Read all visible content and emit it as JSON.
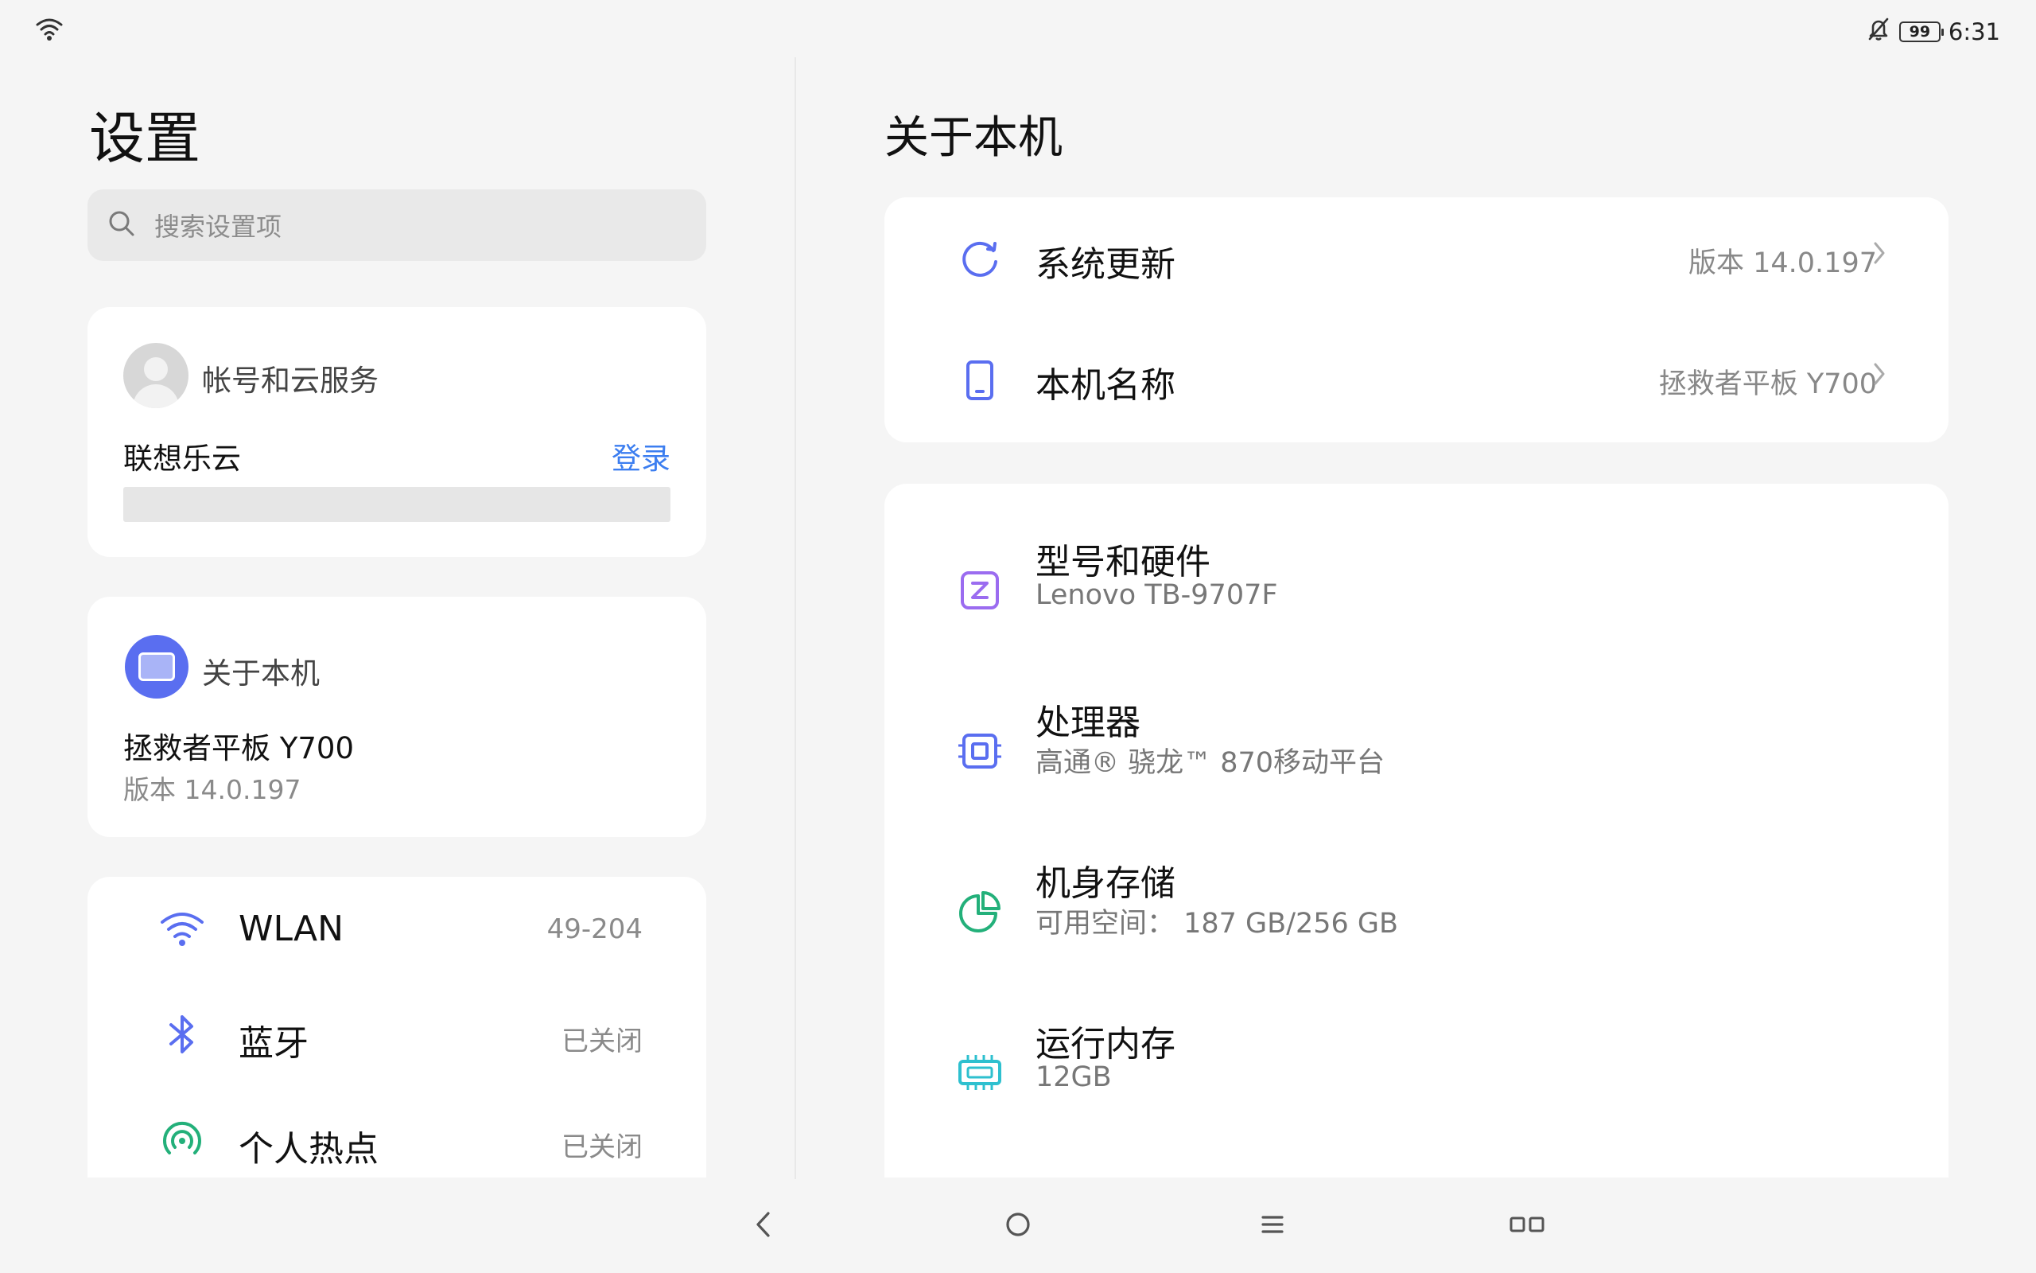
{
  "status_bar": {
    "time": "6:31",
    "battery": "99"
  },
  "left": {
    "title": "设置",
    "search_placeholder": "搜索设置项",
    "account": {
      "title": "帐号和云服务",
      "cloud_name": "联想乐云",
      "login_label": "登录"
    },
    "about": {
      "title": "关于本机",
      "device_name": "拯救者平板 Y700",
      "version": "版本 14.0.197"
    },
    "network": [
      {
        "label": "WLAN",
        "value": "49-204"
      },
      {
        "label": "蓝牙",
        "value": "已关闭"
      },
      {
        "label": "个人热点",
        "value": "已关闭"
      }
    ]
  },
  "right": {
    "title": "关于本机",
    "top_items": [
      {
        "label": "系统更新",
        "value": "版本 14.0.197"
      },
      {
        "label": "本机名称",
        "value": "拯救者平板 Y700"
      }
    ],
    "hardware_items": [
      {
        "label": "型号和硬件",
        "sub": "Lenovo TB-9707F"
      },
      {
        "label": "处理器",
        "sub": "高通® 骁龙™ 870移动平台"
      },
      {
        "label": "机身存储",
        "sub": "可用空间：  187 GB/256 GB"
      },
      {
        "label": "运行内存",
        "sub": "12GB"
      }
    ]
  },
  "colors": {
    "accent_blue": "#3c7ef0",
    "icon_blue": "#5a6ef0",
    "icon_purple": "#9b6cf0",
    "icon_green": "#23b07a",
    "icon_cyan": "#2ec0cf"
  }
}
